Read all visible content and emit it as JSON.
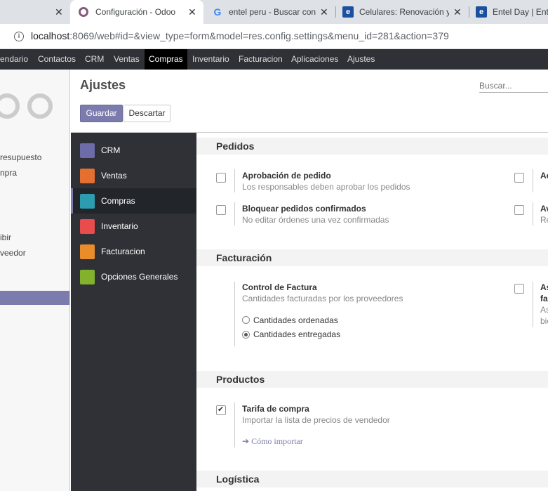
{
  "browser": {
    "tabs": [
      {
        "title": ""
      },
      {
        "title": "Configuración - Odoo"
      },
      {
        "title": "entel peru - Buscar con Google"
      },
      {
        "title": "Celulares: Renovación y Portabilidad"
      },
      {
        "title": "Entel Day | Entel"
      }
    ],
    "url_host": "localhost",
    "url_rest": ":8069/web#id=&view_type=form&model=res.config.settings&menu_id=281&action=379"
  },
  "topmenu": {
    "items": [
      "endario",
      "Contactos",
      "CRM",
      "Ventas",
      "Compras",
      "Inventario",
      "Facturacion",
      "Aplicaciones",
      "Ajustes"
    ]
  },
  "app_sidebar": {
    "items": [
      "resupuesto",
      "npra",
      "ibir",
      "veedor"
    ]
  },
  "control_panel": {
    "title": "Ajustes",
    "save_label": "Guardar",
    "discard_label": "Descartar",
    "search_placeholder": "Buscar..."
  },
  "settings_sidebar": {
    "items": [
      {
        "label": "CRM",
        "icon": "crm-icon",
        "color": "#6d6ba8"
      },
      {
        "label": "Ventas",
        "icon": "sales-icon",
        "color": "#e46f2f"
      },
      {
        "label": "Compras",
        "icon": "purchase-icon",
        "color": "#2c9cb0"
      },
      {
        "label": "Inventario",
        "icon": "inventory-icon",
        "color": "#e84c4c"
      },
      {
        "label": "Facturacion",
        "icon": "invoicing-icon",
        "color": "#e88d2a"
      },
      {
        "label": "Opciones Generales",
        "icon": "gear-icon",
        "color": "#82b22c"
      }
    ]
  },
  "sections": {
    "pedidos": {
      "heading": "Pedidos",
      "aprobacion_title": "Aprobación de pedido",
      "aprobacion_desc": "Los responsables deben aprobar los pedidos",
      "bloquear_title": "Bloquear pedidos confirmados",
      "bloquear_desc": "No editar órdenes una vez confirmadas",
      "right1_title": "Ac",
      "right2_title": "Av",
      "right2_desc": "Re"
    },
    "facturacion": {
      "heading": "Facturación",
      "control_title": "Control de Factura",
      "control_desc": "Cantidades facturadas por los proveedores",
      "radio1": "Cantidades ordenadas",
      "radio2": "Cantidades entregadas",
      "right_title1": "As",
      "right_title2": "fa",
      "right_desc1": "As",
      "right_desc2": "bie"
    },
    "productos": {
      "heading": "Productos",
      "tarifa_title": "Tarifa de compra",
      "tarifa_desc": "Importar la lista de precios de vendedor",
      "import_link": "Cómo importar"
    },
    "logistica": {
      "heading": "Logística"
    }
  }
}
